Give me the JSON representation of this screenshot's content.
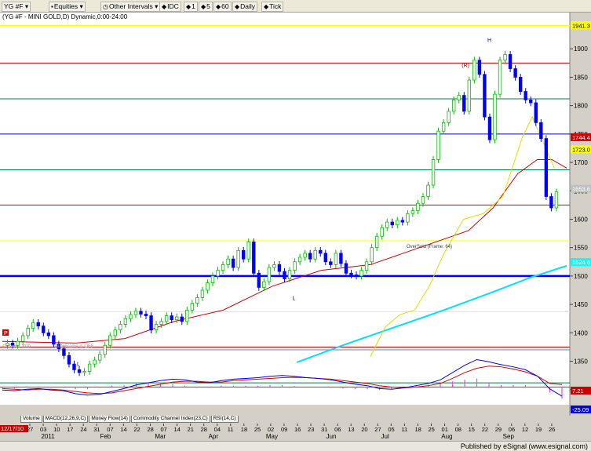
{
  "toolbar": {
    "symbol": "YG #F",
    "asset_class": "Equities",
    "interval_menu": "Other Intervals",
    "interval_buttons": [
      "IDC",
      "1",
      "5",
      "60",
      "Daily",
      "Tick"
    ]
  },
  "chart_header": "(YG #F - MINI GOLD,D) Dynamic,0:00-24:00",
  "watermarks": {
    "copyright": "© eSignal, 2010",
    "autoframe": "AutoFrame is OFF"
  },
  "annotation_oversold": "OverSold (Frame: 64)",
  "price_axis": {
    "ticks": [
      1300,
      1350,
      1400,
      1450,
      1500,
      1550,
      1600,
      1650,
      1700,
      1750,
      1800,
      1850,
      1900
    ],
    "ylim": [
      1290,
      1950
    ],
    "badges": [
      {
        "label": "1941.3",
        "value": 1941.3,
        "color": "#ffff00",
        "text_color": "#000000"
      },
      {
        "label": "1744.4",
        "value": 1744.4,
        "color": "#d00000",
        "text_color": "#ffffff"
      },
      {
        "label": "1723.0",
        "value": 1723.0,
        "color": "#ffff00",
        "text_color": "#000000"
      },
      {
        "label": "1653.6",
        "value": 1653.6,
        "color": "#c0c0c0",
        "text_color": "#ffffff"
      },
      {
        "label": "1524.6",
        "value": 1524.6,
        "color": "#00ffff",
        "text_color": "#ffffff"
      }
    ]
  },
  "macd_badges": [
    {
      "label": "7.21",
      "color": "#d00000",
      "text_color": "#ffffff"
    },
    {
      "label": "-25.09",
      "color": "#0000ff",
      "text_color": "#ffffff"
    }
  ],
  "time_axis": {
    "date_badge": "12/17/10",
    "day_labels": [
      "27",
      "03",
      "10",
      "17",
      "24",
      "31",
      "07",
      "14",
      "22",
      "28",
      "07",
      "14",
      "21",
      "28",
      "04",
      "11",
      "18",
      "25",
      "02",
      "09",
      "16",
      "23",
      "31",
      "06",
      "13",
      "20",
      "27",
      "05",
      "11",
      "18",
      "25",
      "01",
      "08",
      "15",
      "22",
      "29",
      "06",
      "12",
      "19",
      "26"
    ],
    "month_labels": [
      {
        "label": "2011",
        "index": 1.2
      },
      {
        "label": "Feb",
        "index": 5.6
      },
      {
        "label": "Mar",
        "index": 9.7
      },
      {
        "label": "Apr",
        "index": 13.7
      },
      {
        "label": "May",
        "index": 18
      },
      {
        "label": "Jun",
        "index": 22.5
      },
      {
        "label": "Jul",
        "index": 26.6
      },
      {
        "label": "Aug",
        "index": 31.1
      },
      {
        "label": "Sep",
        "index": 35.7
      }
    ]
  },
  "study_tabs": [
    "Volume",
    "MACD(12,26,9,C)",
    "Money Flow(14)",
    "Commodity Channel Index(23,C)",
    "RSI(14,C)"
  ],
  "status": {
    "text": "Published by eSignal (www.esignal.com)"
  },
  "colors": {
    "bull": "#00c000",
    "bear": "#0000ff",
    "bg": "#ffffff"
  },
  "chart_data": {
    "type": "candlestick",
    "title": "(YG #F - MINI GOLD,D) Dynamic,0:00-24:00",
    "x_unit": "week index (labelled by week-start day)",
    "ylim": [
      1290,
      1950
    ],
    "horizontal_levels": [
      {
        "value": 1941,
        "color": "#ffff00"
      },
      {
        "value": 1875,
        "color": "#d00000"
      },
      {
        "value": 1812,
        "color": "#008040"
      },
      {
        "value": 1750,
        "color": "#0000c0"
      },
      {
        "value": 1687,
        "color": "#008040"
      },
      {
        "value": 1625,
        "color": "#d00000"
      },
      {
        "value": 1562,
        "color": "#ffff00"
      },
      {
        "value": 1500,
        "color": "#0000ff",
        "heavy": true
      },
      {
        "value": 1437,
        "color": "#ffff00"
      },
      {
        "value": 1375,
        "color": "#d00000"
      },
      {
        "value": 1312,
        "color": "#008040"
      }
    ],
    "closes": [
      1382,
      1378,
      1385,
      1395,
      1408,
      1418,
      1412,
      1400,
      1395,
      1380,
      1372,
      1360,
      1345,
      1335,
      1330,
      1332,
      1345,
      1352,
      1362,
      1378,
      1395,
      1405,
      1415,
      1425,
      1432,
      1438,
      1433,
      1430,
      1405,
      1415,
      1420,
      1430,
      1423,
      1428,
      1420,
      1440,
      1452,
      1462,
      1475,
      1488,
      1500,
      1510,
      1520,
      1530,
      1515,
      1545,
      1530,
      1560,
      1505,
      1480,
      1490,
      1515,
      1520,
      1508,
      1495,
      1510,
      1525,
      1533,
      1540,
      1530,
      1545,
      1540,
      1525,
      1520,
      1540,
      1522,
      1505,
      1502,
      1500,
      1510,
      1525,
      1550,
      1570,
      1585,
      1595,
      1590,
      1598,
      1595,
      1610,
      1615,
      1628,
      1640,
      1660,
      1705,
      1755,
      1770,
      1790,
      1810,
      1818,
      1790,
      1845,
      1880,
      1855,
      1780,
      1740,
      1820,
      1880,
      1890,
      1865,
      1850,
      1825,
      1810,
      1805,
      1770,
      1742,
      1640,
      1620,
      1648
    ],
    "upper_envelope": [
      [
        1500,
        1358
      ],
      [
        1560,
        1410
      ],
      [
        1620,
        1432
      ],
      [
        1680,
        1440
      ],
      [
        1740,
        1482
      ],
      [
        1800,
        1540
      ],
      [
        1880,
        1600
      ],
      [
        1960,
        1610
      ],
      [
        2040,
        1640
      ],
      [
        2120,
        1745
      ],
      [
        2160,
        1780
      ],
      [
        2200,
        1740
      ],
      [
        2250,
        1690
      ]
    ],
    "sma_50": [
      [
        0,
        1385
      ],
      [
        300,
        1382
      ],
      [
        500,
        1390
      ],
      [
        700,
        1420
      ],
      [
        900,
        1440
      ],
      [
        1100,
        1482
      ],
      [
        1300,
        1510
      ],
      [
        1500,
        1520
      ],
      [
        1700,
        1550
      ],
      [
        1900,
        1580
      ],
      [
        2000,
        1620
      ],
      [
        2100,
        1680
      ],
      [
        2180,
        1705
      ],
      [
        2240,
        1705
      ],
      [
        2300,
        1690
      ]
    ],
    "sma_200": [
      [
        1200,
        1348
      ],
      [
        1400,
        1380
      ],
      [
        1600,
        1410
      ],
      [
        1800,
        1440
      ],
      [
        2000,
        1472
      ],
      [
        2150,
        1497
      ],
      [
        2300,
        1518
      ]
    ],
    "markers": [
      {
        "text": "H",
        "value": 1912,
        "index": 94
      },
      {
        "text": "(R)",
        "value": 1868,
        "index": 89
      },
      {
        "text": "L",
        "value": 1458,
        "index": 56
      },
      {
        "text": "L",
        "value": 1342,
        "index": 14
      }
    ],
    "macd": {
      "ylim": [
        -40,
        90
      ],
      "zero": 0,
      "macd_line": [
        -8,
        -10,
        -6,
        -4,
        -8,
        -10,
        -18,
        -22,
        -20,
        -12,
        -4,
        6,
        12,
        18,
        22,
        20,
        14,
        12,
        18,
        22,
        24,
        26,
        30,
        32,
        30,
        26,
        24,
        20,
        14,
        8,
        4,
        -4,
        -6,
        -2,
        4,
        10,
        20,
        40,
        60,
        76,
        70,
        62,
        56,
        48,
        30,
        -5,
        -25
      ],
      "signal_line": [
        -4,
        -6,
        -8,
        -6,
        -6,
        -8,
        -12,
        -16,
        -18,
        -16,
        -10,
        -4,
        2,
        8,
        14,
        16,
        16,
        14,
        14,
        18,
        20,
        22,
        24,
        26,
        27,
        26,
        24,
        22,
        18,
        14,
        10,
        4,
        0,
        -2,
        0,
        4,
        10,
        24,
        40,
        52,
        58,
        56,
        50,
        42,
        30,
        10,
        7
      ]
    }
  }
}
